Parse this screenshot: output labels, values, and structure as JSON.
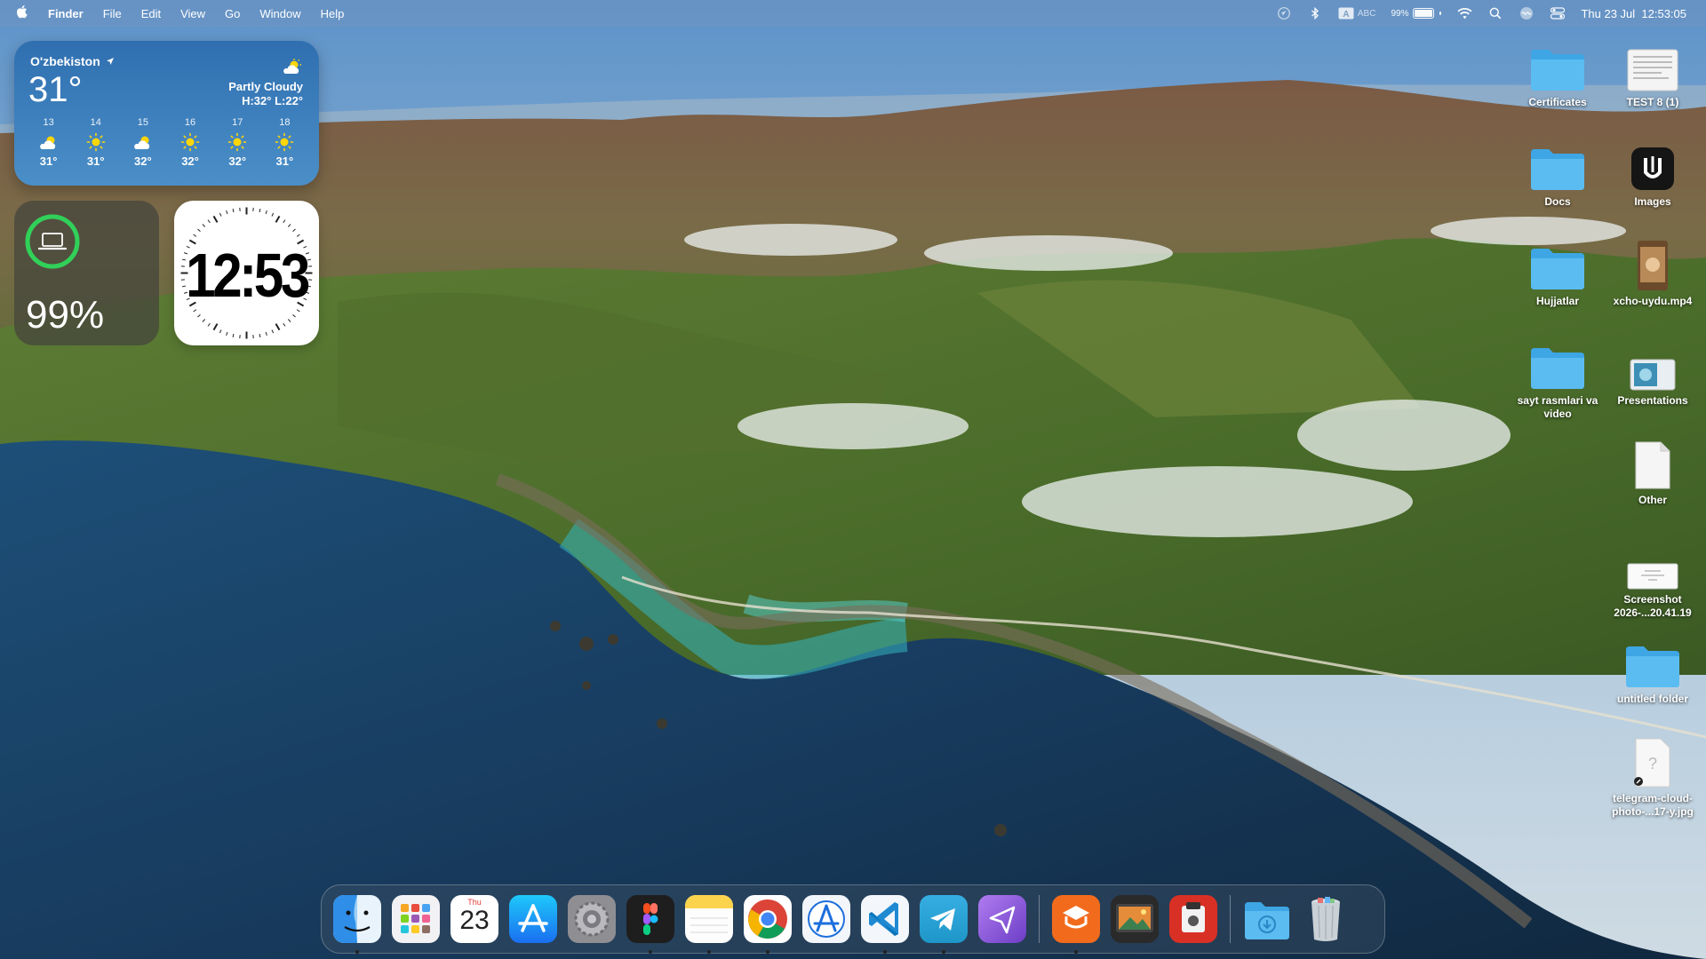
{
  "menubar": {
    "app_name": "Finder",
    "menus": [
      "File",
      "Edit",
      "View",
      "Go",
      "Window",
      "Help"
    ],
    "keyboard_input": "ABC",
    "battery_percent": "99%",
    "battery_level": 0.99,
    "datetime": "Thu 23 Jul  12:53:05",
    "status_icons": [
      "location-icon",
      "bluetooth-icon",
      "input-source-icon",
      "battery-icon",
      "wifi-icon",
      "spotlight-icon",
      "siri-icon",
      "control-center-icon"
    ]
  },
  "weather": {
    "location": "O'zbekiston",
    "temp": "31°",
    "condition": "Partly Cloudy",
    "hilo": "H:32° L:22°",
    "forecast": [
      {
        "day": "13",
        "icon": "partly-cloudy-icon",
        "temp": "31°"
      },
      {
        "day": "14",
        "icon": "sun-icon",
        "temp": "31°"
      },
      {
        "day": "15",
        "icon": "partly-cloudy-icon",
        "temp": "32°"
      },
      {
        "day": "16",
        "icon": "sun-icon",
        "temp": "32°"
      },
      {
        "day": "17",
        "icon": "sun-icon",
        "temp": "32°"
      },
      {
        "day": "18",
        "icon": "sun-icon",
        "temp": "31°"
      }
    ]
  },
  "battery_widget": {
    "percent": "99%",
    "level": 0.99,
    "ring_color": "#30d158"
  },
  "clock_widget": {
    "time": "12:53"
  },
  "desktop": {
    "items": [
      {
        "label": "Certificates",
        "icon": "folder-icon"
      },
      {
        "label": "TEST 8 (1)",
        "icon": "document-icon"
      },
      {
        "label": "Docs",
        "icon": "folder-icon"
      },
      {
        "label": "Images",
        "icon": "app-icon"
      },
      {
        "label": "Hujjatlar",
        "icon": "folder-icon"
      },
      {
        "label": "xcho-uydu.mp4",
        "icon": "video-icon"
      },
      {
        "label": "sayt rasmlari va video",
        "icon": "folder-icon"
      },
      {
        "label": "Presentations",
        "icon": "presentation-icon"
      },
      {
        "label": "Other",
        "icon": "document-icon"
      },
      {
        "label": "Screenshot 2026-...20.41.19",
        "icon": "screenshot-icon"
      },
      {
        "label": "untitled folder",
        "icon": "folder-icon"
      },
      {
        "label": "telegram-cloud-photo-...17-y.jpg",
        "icon": "image-file-icon"
      }
    ]
  },
  "dock": {
    "calendar_month": "Thu",
    "calendar_day": "23",
    "apps": [
      {
        "name": "Finder",
        "icon": "finder-icon",
        "running": true
      },
      {
        "name": "Launchpad",
        "icon": "launchpad-icon",
        "running": false
      },
      {
        "name": "Calendar",
        "icon": "calendar-icon",
        "running": false
      },
      {
        "name": "App Store",
        "icon": "app-store-icon",
        "running": false
      },
      {
        "name": "System Preferences",
        "icon": "settings-icon",
        "running": false
      },
      {
        "name": "Figma",
        "icon": "figma-icon",
        "running": true
      },
      {
        "name": "Notes",
        "icon": "notes-icon",
        "running": true
      },
      {
        "name": "Chrome",
        "icon": "chrome-icon",
        "running": true
      },
      {
        "name": "Xcode Instruments",
        "icon": "instruments-icon",
        "running": false
      },
      {
        "name": "VS Code",
        "icon": "vscode-icon",
        "running": true
      },
      {
        "name": "Telegram",
        "icon": "telegram-icon",
        "running": true
      },
      {
        "name": "Direct Mail",
        "icon": "send-icon",
        "running": false
      },
      {
        "name": "Recent App 1",
        "icon": "orange-app-icon",
        "running": true
      },
      {
        "name": "Recent App 2",
        "icon": "photo-app-icon",
        "running": false
      },
      {
        "name": "Recent App 3",
        "icon": "red-app-icon",
        "running": false
      },
      {
        "name": "Downloads",
        "icon": "downloads-folder-icon",
        "running": false
      },
      {
        "name": "Trash",
        "icon": "trash-icon",
        "running": false
      }
    ]
  }
}
